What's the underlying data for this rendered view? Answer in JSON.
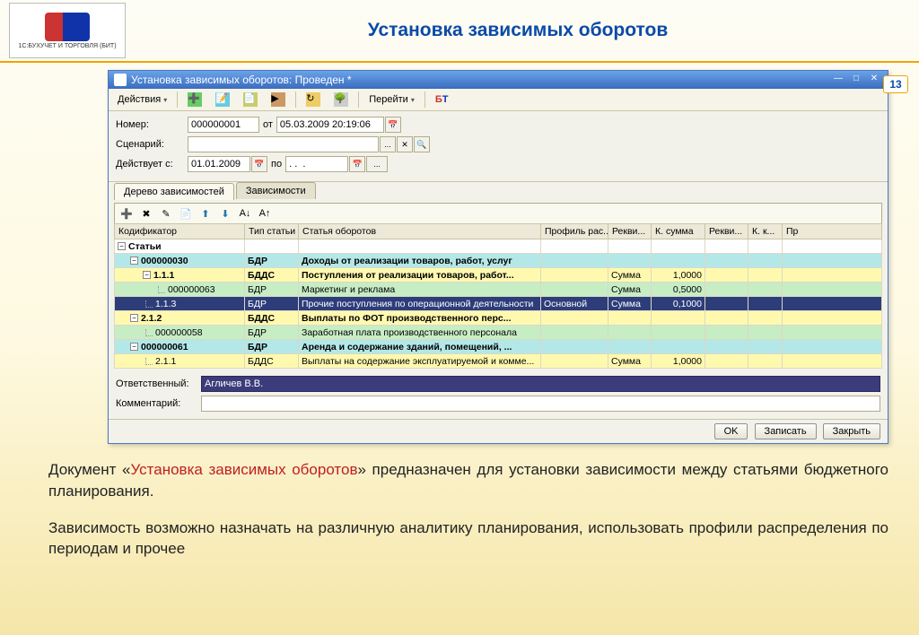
{
  "page": {
    "title": "Установка зависимых оборотов",
    "number": "13",
    "logo_caption": "1С:БУХУЧЕТ И ТОРГОВЛЯ (БИТ)"
  },
  "window": {
    "title": "Установка зависимых оборотов: Проведен *",
    "actions_label": "Действия",
    "goto_label": "Перейти"
  },
  "form": {
    "number_label": "Номер:",
    "number_value": "000000001",
    "from_label": "от",
    "date_value": "05.03.2009 20:19:06",
    "scenario_label": "Сценарий:",
    "scenario_value": "",
    "valid_from_label": "Действует с:",
    "valid_from_value": "01.01.2009",
    "to_label": "по",
    "to_value": ". .  .",
    "responsible_label": "Ответственный:",
    "responsible_value": "Агличев В.В.",
    "comment_label": "Комментарий:",
    "comment_value": ""
  },
  "tabs": {
    "tab1": "Дерево зависимостей",
    "tab2": "Зависимости"
  },
  "columns": {
    "c0": "Кодификатор",
    "c1": "Тип статьи",
    "c2": "Статья оборотов",
    "c3": "Профиль рас...",
    "c4": "Рекви...",
    "c5": "К. сумма",
    "c6": "Рекви...",
    "c7": "К. к...",
    "c8": "Пр"
  },
  "rows": [
    {
      "cls": "row-white",
      "tree": "⊟",
      "indent": 0,
      "code": "Статьи",
      "bold": true,
      "type": "",
      "article": "",
      "profile": "",
      "r1": "",
      "ksum": "",
      "r2": "",
      "kk": ""
    },
    {
      "cls": "row-cyan",
      "tree": "⊟",
      "indent": 1,
      "code": "000000030",
      "bold": true,
      "type": "БДР",
      "article": "Доходы от реализации товаров, работ, услуг",
      "profile": "",
      "r1": "",
      "ksum": "",
      "r2": "",
      "kk": ""
    },
    {
      "cls": "row-yellow",
      "tree": "⊟",
      "indent": 2,
      "code": "1.1.1",
      "bold": true,
      "type": "БДДС",
      "article": "Поступления от реализации товаров, работ...",
      "profile": "",
      "r1": "Сумма",
      "ksum": "1,0000",
      "r2": "",
      "kk": ""
    },
    {
      "cls": "row-green",
      "tree": "└",
      "indent": 3,
      "code": "000000063",
      "bold": false,
      "type": "БДР",
      "article": "Маркетинг и реклама",
      "profile": "",
      "r1": "Сумма",
      "ksum": "0,5000",
      "r2": "",
      "kk": ""
    },
    {
      "cls": "row-navy",
      "tree": "└",
      "indent": 2,
      "code": "1.1.3",
      "bold": false,
      "type": "БДР",
      "article": "Прочие поступления по операционной деятельности",
      "profile": "Основной",
      "r1": "Сумма",
      "ksum": "0,1000",
      "r2": "",
      "kk": ""
    },
    {
      "cls": "row-yellow",
      "tree": "⊟",
      "indent": 1,
      "code": "2.1.2",
      "bold": true,
      "type": "БДДС",
      "article": "Выплаты по ФОТ производственного перс...",
      "profile": "",
      "r1": "",
      "ksum": "",
      "r2": "",
      "kk": ""
    },
    {
      "cls": "row-green",
      "tree": "└",
      "indent": 2,
      "code": "000000058",
      "bold": false,
      "type": "БДР",
      "article": "Заработная плата производственного персонала",
      "profile": "",
      "r1": "",
      "ksum": "",
      "r2": "",
      "kk": ""
    },
    {
      "cls": "row-cyan",
      "tree": "⊟",
      "indent": 1,
      "code": "000000061",
      "bold": true,
      "type": "БДР",
      "article": "Аренда и содержание зданий, помещений, ...",
      "profile": "",
      "r1": "",
      "ksum": "",
      "r2": "",
      "kk": ""
    },
    {
      "cls": "row-yellow",
      "tree": "└",
      "indent": 2,
      "code": "2.1.1",
      "bold": false,
      "type": "БДДС",
      "article": "Выплаты на содержание эксплуатируемой и комме...",
      "profile": "",
      "r1": "Сумма",
      "ksum": "1,0000",
      "r2": "",
      "kk": ""
    }
  ],
  "buttons": {
    "ok": "OK",
    "save": "Записать",
    "close": "Закрыть"
  },
  "description": {
    "p1a": "Документ «",
    "p1b": "Установка зависимых оборотов",
    "p1c": "» предназначен для установки зависимости между статьями бюджетного планирования.",
    "p2": "Зависимость возможно назначать на различную аналитику планирования, использовать профили распределения по периодам и прочее"
  }
}
